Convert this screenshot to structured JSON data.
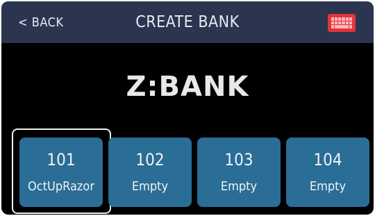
{
  "header": {
    "back_label": "< BACK",
    "title": "CREATE BANK",
    "keyboard_icon": "keyboard-icon",
    "keyboard_color": "#e3343b"
  },
  "bank_name": "Z:BANK",
  "slots": [
    {
      "number": "101",
      "name": "OctUpRazor",
      "selected": true
    },
    {
      "number": "102",
      "name": "Empty",
      "selected": false
    },
    {
      "number": "103",
      "name": "Empty",
      "selected": false
    },
    {
      "number": "104",
      "name": "Empty",
      "selected": false
    }
  ],
  "colors": {
    "header_bg": "#2b3550",
    "screen_bg": "#000000",
    "slot_bg": "#2a6d96",
    "selection_outline": "#f0f0f0"
  }
}
